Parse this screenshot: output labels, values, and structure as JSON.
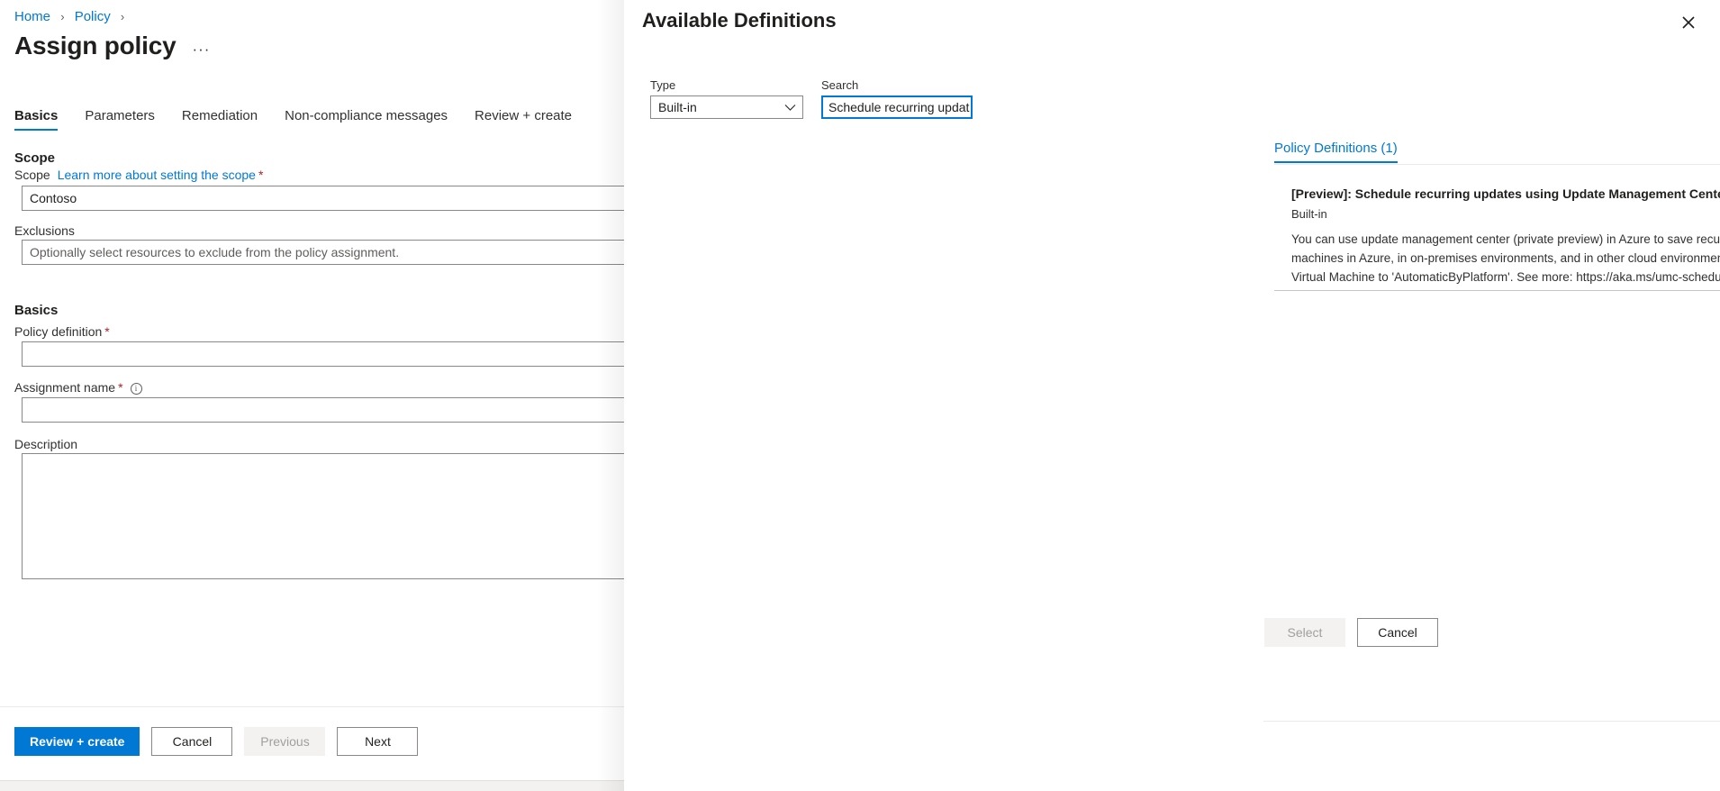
{
  "breadcrumb": {
    "items": [
      "Home",
      "Policy"
    ],
    "separator": "›"
  },
  "page": {
    "title": "Assign policy",
    "more_label": "···"
  },
  "tabs": [
    {
      "label": "Basics",
      "active": true
    },
    {
      "label": "Parameters",
      "active": false
    },
    {
      "label": "Remediation",
      "active": false
    },
    {
      "label": "Non-compliance messages",
      "active": false
    },
    {
      "label": "Review + create",
      "active": false
    }
  ],
  "form": {
    "scope_section_title": "Scope",
    "scope_label": "Scope",
    "scope_link": "Learn more about setting the scope",
    "scope_required": "*",
    "scope_value": "Contoso",
    "exclusions_label": "Exclusions",
    "exclusions_placeholder": "Optionally select resources to exclude from the policy assignment.",
    "basics_section_title": "Basics",
    "policy_definition_label": "Policy definition",
    "policy_definition_required": "*",
    "policy_definition_value": "",
    "assignment_name_label": "Assignment name",
    "assignment_name_required": "*",
    "assignment_name_info": "i",
    "assignment_name_value": "",
    "description_label": "Description",
    "description_value": ""
  },
  "footer": {
    "review_create": "Review + create",
    "cancel": "Cancel",
    "previous": "Previous",
    "next": "Next"
  },
  "pane": {
    "title": "Available Definitions",
    "close_icon": "close-icon",
    "type_label": "Type",
    "type_value": "Built-in",
    "type_chevron": "chevron-down-icon",
    "search_label": "Search",
    "search_value": "Schedule recurring updat",
    "definitions_tab": "Policy Definitions (1)",
    "results": [
      {
        "title": "[Preview]: Schedule recurring updates using Update Management Center",
        "subtitle": "Built-in",
        "description": "You can use update management center (private preview) in Azure to save recurring deployment schedules to install operating system updates for your Windows Server and Linux machines in Azure, in on-premises environments, and in other cloud environments connected using Azure Arc-enabled servers. This policy will also change the patch mode for the Azure Virtual Machine to 'AutomaticByPlatform'. See more: https://aka.ms/umc-scheduled-patching"
      }
    ],
    "select_button": "Select",
    "cancel_button": "Cancel"
  },
  "colors": {
    "accent": "#0078d4",
    "required_asterisk": "#a4262c",
    "text_primary": "#201f1e",
    "text_secondary": "#605e5c",
    "border": "#8a8886"
  }
}
